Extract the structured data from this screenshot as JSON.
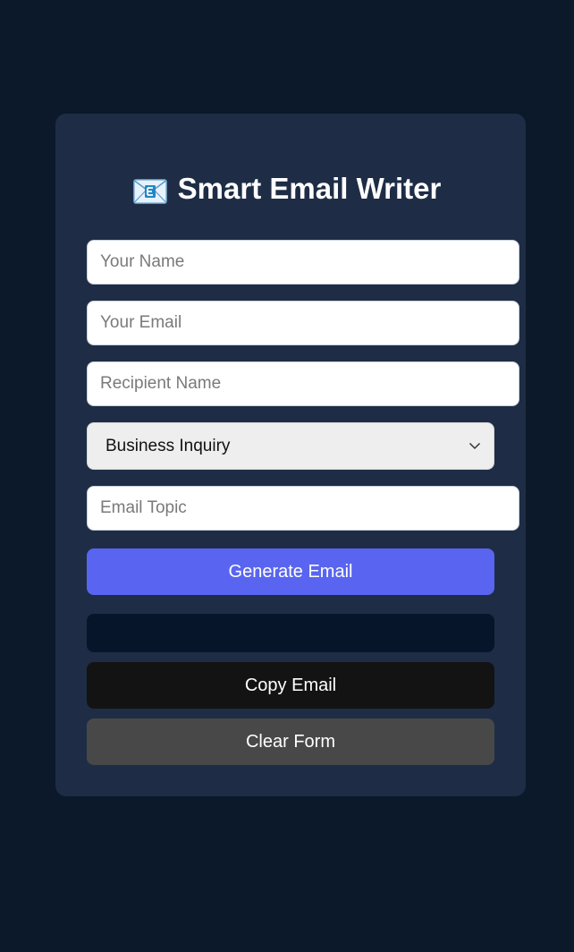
{
  "app": {
    "title": "Smart Email Writer",
    "title_icon": "envelope-icon"
  },
  "form": {
    "your_name": {
      "placeholder": "Your Name",
      "value": ""
    },
    "your_email": {
      "placeholder": "Your Email",
      "value": ""
    },
    "recipient_name": {
      "placeholder": "Recipient Name",
      "value": ""
    },
    "email_type": {
      "selected": "Business Inquiry"
    },
    "email_topic": {
      "placeholder": "Email Topic",
      "value": ""
    }
  },
  "actions": {
    "generate_label": "Generate Email",
    "copy_label": "Copy Email",
    "clear_label": "Clear Form"
  },
  "output": {
    "text": ""
  },
  "colors": {
    "page_bg": "#0c192a",
    "card_bg": "#1e2d45",
    "accent": "#5965f0",
    "copy_bg": "#131313",
    "clear_bg": "#484848",
    "output_bg": "#07152a"
  }
}
